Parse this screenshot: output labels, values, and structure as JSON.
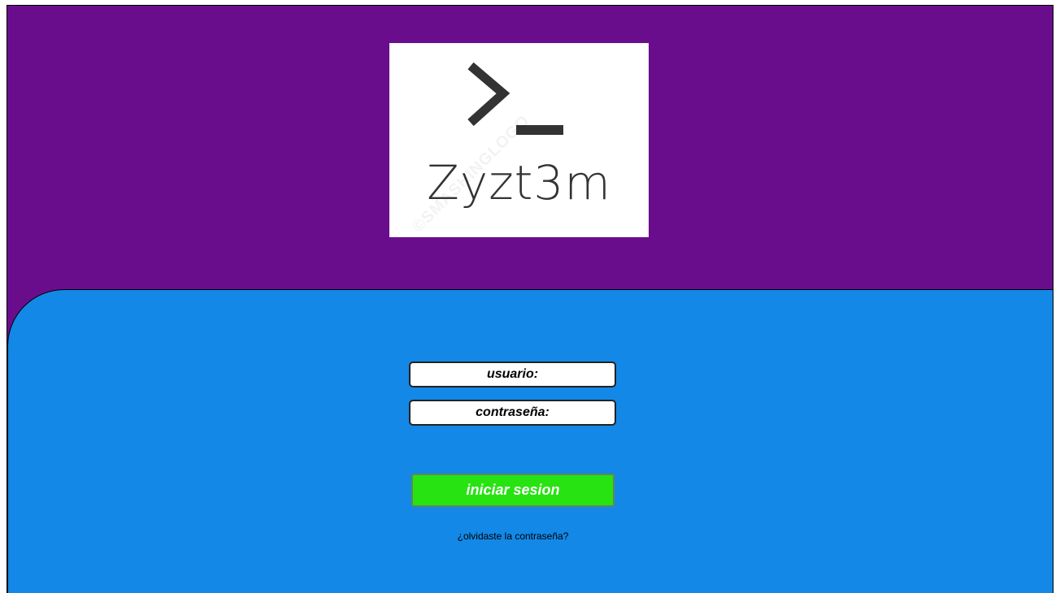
{
  "logo": {
    "prompt_icon": "terminal-prompt-icon",
    "brand_text": "Zyzt3m",
    "watermark_text": "©SMASHINGLOGO"
  },
  "login": {
    "username_placeholder": "usuario:",
    "password_placeholder": "contraseña:",
    "submit_label": "iniciar sesion",
    "forgot_label": "¿olvidaste la contraseña?"
  },
  "colors": {
    "header_bg": "#6a0d8d",
    "form_bg": "#1388e6",
    "button_bg": "#27e312",
    "logo_bg": "#ffffff",
    "logo_ink": "#333333"
  }
}
